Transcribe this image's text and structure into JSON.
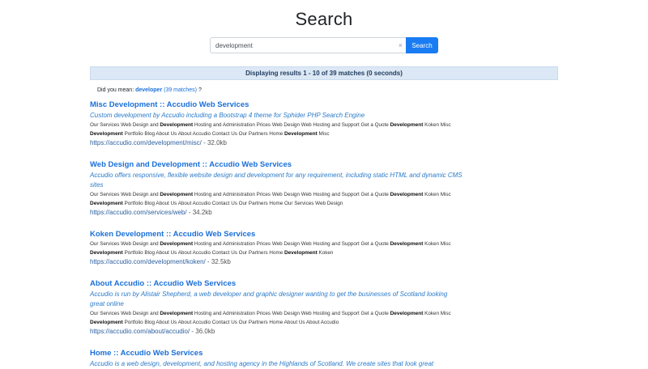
{
  "page": {
    "title": "Search"
  },
  "search": {
    "value": "development",
    "placeholder": "",
    "button_label": "Search",
    "clear_icon": "×"
  },
  "results_info": "Displaying results 1 - 10 of 39 matches (0 seconds)",
  "did_you_mean": {
    "prefix": "Did you mean:",
    "suggestion": "developer",
    "count": "(39 matches)",
    "suffix": "?"
  },
  "results": [
    {
      "title": [
        {
          "t": "Misc ",
          "b": false
        },
        {
          "t": "Development",
          "b": true
        },
        {
          "t": " :: Accudio Web Services",
          "b": false
        }
      ],
      "description": "Custom development by Accudio including a Bootstrap 4 theme for Sphider PHP Search Engine",
      "snippet": [
        {
          "t": "Our Services Web Design and ",
          "b": false
        },
        {
          "t": "Development",
          "b": true
        },
        {
          "t": " Hosting and Administration Prices Web Design Web Hosting and Support Get a Quote ",
          "b": false
        },
        {
          "t": "Development",
          "b": true
        },
        {
          "t": " Koken Misc ",
          "b": false
        },
        {
          "t": "Development",
          "b": true
        },
        {
          "t": " Portfolio Blog About Us About Accudio Contact Us Our Partners Home ",
          "b": false
        },
        {
          "t": "Development",
          "b": true
        },
        {
          "t": " Misc",
          "b": false
        }
      ],
      "url": "https://accudio.com/development/misc/",
      "size": " - 32.0kb"
    },
    {
      "title": [
        {
          "t": "Web Design and ",
          "b": false
        },
        {
          "t": "Development",
          "b": true
        },
        {
          "t": " :: Accudio Web Services",
          "b": false
        }
      ],
      "description": "Accudio offers responsive, flexible website design and development for any requirement, including static HTML and dynamic CMS sites",
      "snippet": [
        {
          "t": "Our Services Web Design and ",
          "b": false
        },
        {
          "t": "Development",
          "b": true
        },
        {
          "t": " Hosting and Administration Prices Web Design Web Hosting and Support Get a Quote ",
          "b": false
        },
        {
          "t": "Development",
          "b": true
        },
        {
          "t": " Koken Misc ",
          "b": false
        },
        {
          "t": "Development",
          "b": true
        },
        {
          "t": " Portfolio Blog About Us About Accudio Contact Us Our Partners Home Our Services Web Design",
          "b": false
        }
      ],
      "url": "https://accudio.com/services/web/",
      "size": " - 34.2kb"
    },
    {
      "title": [
        {
          "t": "Koken ",
          "b": false
        },
        {
          "t": "Development",
          "b": true
        },
        {
          "t": " :: Accudio Web Services",
          "b": false
        }
      ],
      "description": "",
      "snippet": [
        {
          "t": "Our Services Web Design and ",
          "b": false
        },
        {
          "t": "Development",
          "b": true
        },
        {
          "t": " Hosting and Administration Prices Web Design Web Hosting and Support Get a Quote ",
          "b": false
        },
        {
          "t": "Development",
          "b": true
        },
        {
          "t": " Koken Misc ",
          "b": false
        },
        {
          "t": "Development",
          "b": true
        },
        {
          "t": " Portfolio Blog About Us About Accudio Contact Us Our Partners Home ",
          "b": false
        },
        {
          "t": "Development",
          "b": true
        },
        {
          "t": " Koken",
          "b": false
        }
      ],
      "url": "https://accudio.com/development/koken/",
      "size": " - 32.5kb"
    },
    {
      "title": [
        {
          "t": "About Accudio :: Accudio Web Services",
          "b": false
        }
      ],
      "description": "Accudio is run by Alistair Shepherd, a web developer and graphic designer wanting to get the businesses of Scotland looking great online",
      "snippet": [
        {
          "t": "Our Services Web Design and ",
          "b": false
        },
        {
          "t": "Development",
          "b": true
        },
        {
          "t": " Hosting and Administration Prices Web Design Web Hosting and Support Get a Quote ",
          "b": false
        },
        {
          "t": "Development",
          "b": true
        },
        {
          "t": " Koken Misc ",
          "b": false
        },
        {
          "t": "Development",
          "b": true
        },
        {
          "t": " Portfolio Blog About Us About Accudio Contact Us Our Partners Home About Us About Accudio",
          "b": false
        }
      ],
      "url": "https://accudio.com/about/accudio/",
      "size": " - 36.0kb"
    },
    {
      "title": [
        {
          "t": "Home :: Accudio Web Services",
          "b": false
        }
      ],
      "description": "Accudio is a web design, development, and hosting agency in the Highlands of Scotland. We create sites that look great",
      "snippet": [],
      "url": "",
      "size": ""
    }
  ]
}
